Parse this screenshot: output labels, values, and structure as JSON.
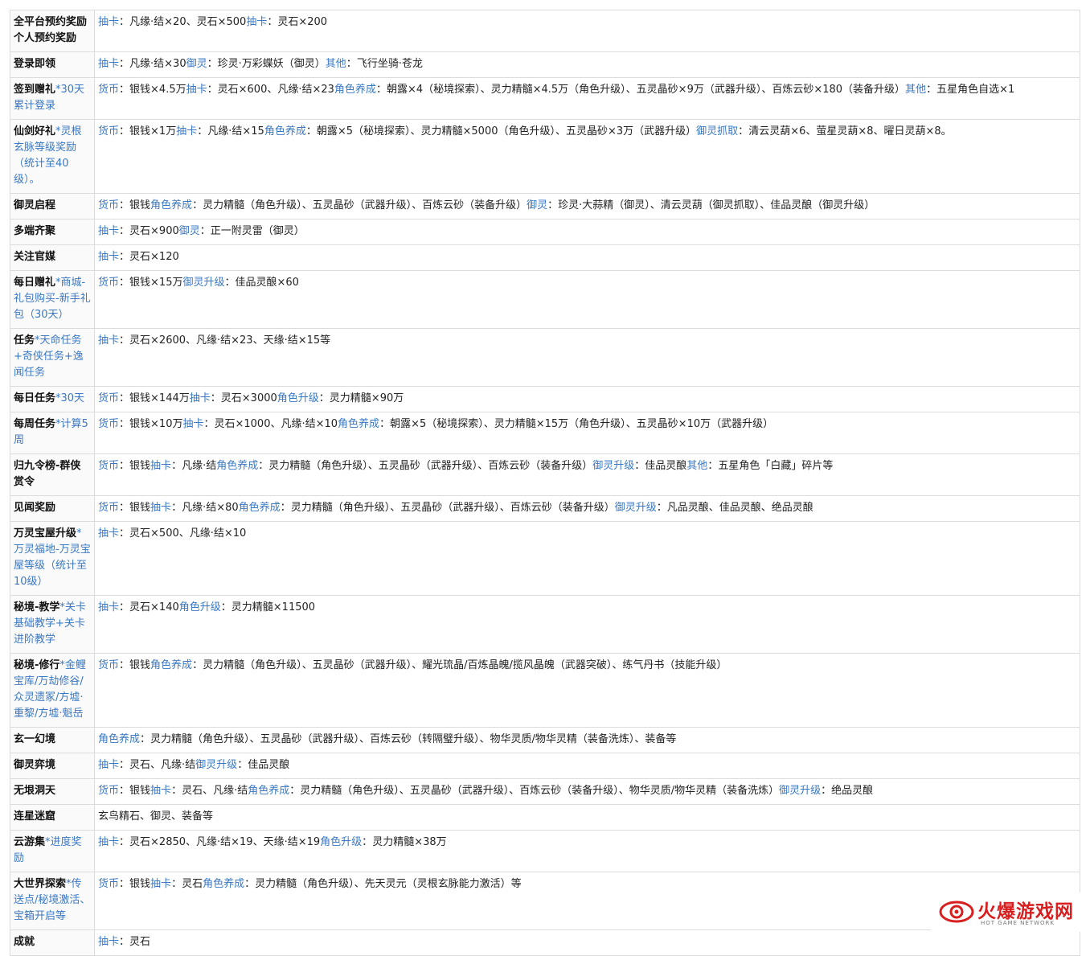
{
  "rows": [
    {
      "source": "全平台预约奖励个人预约奖励",
      "note": "",
      "segments": [
        {
          "cat": "抽卡",
          "text": "凡缘·结×20、灵石×500"
        },
        {
          "cat": "抽卡",
          "text": "灵石×200"
        }
      ]
    },
    {
      "source": "登录即领",
      "note": "",
      "segments": [
        {
          "cat": "抽卡",
          "text": "凡缘·结×30"
        },
        {
          "cat": "御灵",
          "text": "珍灵·万彩蝶妖（御灵）"
        },
        {
          "cat": "其他",
          "text": "飞行坐骑·苍龙"
        }
      ]
    },
    {
      "source": "签到赠礼",
      "note": "*30天累计登录",
      "segments": [
        {
          "cat": "货币",
          "text": "银钱×4.5万"
        },
        {
          "cat": "抽卡",
          "text": "灵石×600、凡缘·结×23"
        },
        {
          "cat": "角色养成",
          "text": "朝露×4（秘境探索）、灵力精髓×4.5万（角色升级）、五灵晶砂×9万（武器升级）、百炼云砂×180（装备升级）"
        },
        {
          "cat": "其他",
          "text": "五星角色自选×1"
        }
      ]
    },
    {
      "source": "仙剑好礼",
      "note": "*灵根玄脉等级奖励（统计至40级）。",
      "segments": [
        {
          "cat": "货币",
          "text": "银钱×1万"
        },
        {
          "cat": "抽卡",
          "text": "凡缘·结×15"
        },
        {
          "cat": "角色养成",
          "text": "朝露×5（秘境探索）、灵力精髓×5000（角色升级）、五灵晶砂×3万（武器升级）"
        },
        {
          "cat": "御灵抓取",
          "text": "清云灵葫×6、萤星灵葫×8、曜日灵葫×8。"
        }
      ]
    },
    {
      "source": "御灵启程",
      "note": "",
      "segments": [
        {
          "cat": "货币",
          "text": "银钱"
        },
        {
          "cat": "角色养成",
          "text": "灵力精髓（角色升级）、五灵晶砂（武器升级）、百炼云砂（装备升级）"
        },
        {
          "cat": "御灵",
          "text": "珍灵·大蒜精（御灵）、清云灵葫（御灵抓取）、佳品灵酿（御灵升级）"
        }
      ]
    },
    {
      "source": "多端齐聚",
      "note": "",
      "segments": [
        {
          "cat": "抽卡",
          "text": "灵石×900"
        },
        {
          "cat": "御灵",
          "text": "正一附灵雷（御灵）"
        }
      ]
    },
    {
      "source": "关注官媒",
      "note": "",
      "segments": [
        {
          "cat": "抽卡",
          "text": "灵石×120"
        }
      ]
    },
    {
      "source": "每日赠礼",
      "note": "*商城-礼包购买-新手礼包（30天）",
      "segments": [
        {
          "cat": "货币",
          "text": "银钱×15万"
        },
        {
          "cat": "御灵升级",
          "text": "佳品灵酿×60"
        }
      ]
    },
    {
      "source": "任务",
      "note": "*天命任务+奇侠任务+逸闻任务",
      "segments": [
        {
          "cat": "抽卡",
          "text": "灵石×2600、凡缘·结×23、天缘·结×15等"
        }
      ]
    },
    {
      "source": "每日任务",
      "note": "*30天",
      "segments": [
        {
          "cat": "货币",
          "text": "银钱×144万"
        },
        {
          "cat": "抽卡",
          "text": "灵石×3000"
        },
        {
          "cat": "角色升级",
          "text": "灵力精髓×90万"
        }
      ]
    },
    {
      "source": "每周任务",
      "note": "*计算5周",
      "segments": [
        {
          "cat": "货币",
          "text": "银钱×10万"
        },
        {
          "cat": "抽卡",
          "text": "灵石×1000、凡缘·结×10"
        },
        {
          "cat": "角色养成",
          "text": "朝露×5（秘境探索）、灵力精髓×15万（角色升级）、五灵晶砂×10万（武器升级）"
        }
      ]
    },
    {
      "source": "归九令榜-群侠赏令",
      "note": "",
      "segments": [
        {
          "cat": "货币",
          "text": "银钱"
        },
        {
          "cat": "抽卡",
          "text": "凡缘·结"
        },
        {
          "cat": "角色养成",
          "text": "灵力精髓（角色升级）、五灵晶砂（武器升级）、百炼云砂（装备升级）"
        },
        {
          "cat": "御灵升级",
          "text": "佳品灵酿"
        },
        {
          "cat": "其他",
          "text": "五星角色「白藏」碎片等"
        }
      ]
    },
    {
      "source": "见闻奖励",
      "note": "",
      "segments": [
        {
          "cat": "货币",
          "text": "银钱"
        },
        {
          "cat": "抽卡",
          "text": "凡缘·结×80"
        },
        {
          "cat": "角色养成",
          "text": "灵力精髓（角色升级）、五灵晶砂（武器升级）、百炼云砂（装备升级）"
        },
        {
          "cat": "御灵升级",
          "text": "凡品灵酿、佳品灵酿、绝品灵酿"
        }
      ]
    },
    {
      "source": "万灵宝屋升级",
      "note": "*万灵福地-万灵宝屋等级（统计至10级）",
      "segments": [
        {
          "cat": "抽卡",
          "text": "灵石×500、凡缘·结×10"
        }
      ]
    },
    {
      "source": "秘境-教学",
      "note": "*关卡基础教学+关卡进阶教学",
      "segments": [
        {
          "cat": "抽卡",
          "text": "灵石×140"
        },
        {
          "cat": "角色升级",
          "text": "灵力精髓×11500"
        }
      ]
    },
    {
      "source": "秘境-修行",
      "note": "*金鲤宝库/万劫修谷/众灵遗冢/方墟·重黎/方墟·魁岳",
      "segments": [
        {
          "cat": "货币",
          "text": "银钱"
        },
        {
          "cat": "角色养成",
          "text": "灵力精髓（角色升级）、五灵晶砂（武器升级）、耀光琉晶/百炼晶魄/揽风晶魄（武器突破）、练气丹书（技能升级）"
        }
      ]
    },
    {
      "source": "玄一幻境",
      "note": "",
      "segments": [
        {
          "cat": "角色养成",
          "text": "灵力精髓（角色升级）、五灵晶砂（武器升级）、百炼云砂（转隔璧升级）、物华灵质/物华灵精（装备洗炼）、装备等"
        }
      ]
    },
    {
      "source": "御灵弈境",
      "note": "",
      "segments": [
        {
          "cat": "抽卡",
          "text": "灵石、凡缘·结"
        },
        {
          "cat": "御灵升级",
          "text": "佳品灵酿"
        }
      ]
    },
    {
      "source": "无垠洞天",
      "note": "",
      "segments": [
        {
          "cat": "货币",
          "text": "银钱"
        },
        {
          "cat": "抽卡",
          "text": "灵石、凡缘·结"
        },
        {
          "cat": "角色养成",
          "text": "灵力精髓（角色升级）、五灵晶砂（武器升级）、百炼云砂（装备升级）、物华灵质/物华灵精（装备洗炼）"
        },
        {
          "cat": "御灵升级",
          "text": "绝品灵酿"
        }
      ]
    },
    {
      "source": "连星迷窟",
      "note": "",
      "segments": [
        {
          "cat": "",
          "text": "玄鸟精石、御灵、装备等"
        }
      ]
    },
    {
      "source": "云游集",
      "note": "*进度奖励",
      "segments": [
        {
          "cat": "抽卡",
          "text": "灵石×2850、凡缘·结×19、天缘·结×19"
        },
        {
          "cat": "角色升级",
          "text": "灵力精髓×38万"
        }
      ]
    },
    {
      "source": "大世界探索",
      "note": "*传送点/秘境激活、宝箱开启等",
      "segments": [
        {
          "cat": "货币",
          "text": "银钱"
        },
        {
          "cat": "抽卡",
          "text": "灵石"
        },
        {
          "cat": "角色养成",
          "text": "灵力精髓（角色升级）、先天灵元（灵根玄脉能力激活）等"
        }
      ]
    },
    {
      "source": "成就",
      "note": "",
      "segments": [
        {
          "cat": "抽卡",
          "text": "灵石"
        }
      ]
    }
  ],
  "colors": {
    "category": "#3a78c3",
    "border": "#dcdcdc",
    "watermark": "#d81e1e"
  },
  "watermark": {
    "title": "火爆游戏网",
    "subtitle": "HOT GAME NETWORK"
  }
}
